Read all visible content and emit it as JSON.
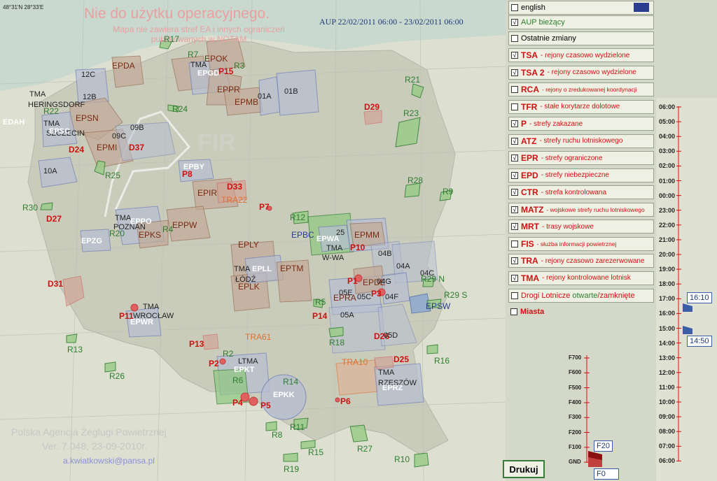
{
  "map": {
    "coords": "48°31'N  28°33'E",
    "warning": "Nie do użytku operacyjnego.",
    "warning_sub": "Mapa nie zawiera stref EA i innych ograniczeń publikowanych w NOTAM",
    "aup_range": "AUP 22/02/2011 06:00 - 23/02/2011 06:00",
    "org_line1": "Polska Agencja Żeglugi Powietrznej",
    "org_line2": "Ver.  7.048,    23-09-2010r.",
    "email": "a.kwiatkowski@pansa.pl",
    "fir": "FIR",
    "labels": [
      {
        "t": "R17",
        "c": "#2e7d2e"
      },
      {
        "t": "EPDA",
        "c": "#7a2a10"
      },
      {
        "t": "12C",
        "c": "#222"
      },
      {
        "t": "12B",
        "c": "#222"
      },
      {
        "t": "TMA",
        "c": "#222"
      },
      {
        "t": "HERINGSDORF",
        "c": "#222"
      },
      {
        "t": "R22",
        "c": "#2e7d2e"
      },
      {
        "t": "EDAH",
        "c": "#fff"
      },
      {
        "t": "EPSN",
        "c": "#7a2a10"
      },
      {
        "t": "TMA",
        "c": "#222"
      },
      {
        "t": "SZCZECIN",
        "c": "#222"
      },
      {
        "t": "EPSC",
        "c": "#fff"
      },
      {
        "t": "D24",
        "c": "#d01010"
      },
      {
        "t": "EPMI",
        "c": "#7a2a10"
      },
      {
        "t": "D37",
        "c": "#d01010"
      },
      {
        "t": "09C",
        "c": "#222"
      },
      {
        "t": "09B",
        "c": "#222"
      },
      {
        "t": "10A",
        "c": "#222"
      },
      {
        "t": "R25",
        "c": "#2e7d2e"
      },
      {
        "t": "R24",
        "c": "#2e7d2e"
      },
      {
        "t": "R7",
        "c": "#2e7d2e"
      },
      {
        "t": "EPOK",
        "c": "#7a2a10"
      },
      {
        "t": "R3",
        "c": "#2e7d2e"
      },
      {
        "t": "TMA",
        "c": "#222"
      },
      {
        "t": "EPGD",
        "c": "#fff"
      },
      {
        "t": "P15",
        "c": "#d01010"
      },
      {
        "t": "EPPR",
        "c": "#7a2a10"
      },
      {
        "t": "EPMB",
        "c": "#7a2a10"
      },
      {
        "t": "01A",
        "c": "#222"
      },
      {
        "t": "01B",
        "c": "#222"
      },
      {
        "t": "R21",
        "c": "#2e7d2e"
      },
      {
        "t": "D29",
        "c": "#d01010"
      },
      {
        "t": "R23",
        "c": "#2e7d2e"
      },
      {
        "t": "EPBY",
        "c": "#fff"
      },
      {
        "t": "P8",
        "c": "#d01010"
      },
      {
        "t": "D33",
        "c": "#d01010"
      },
      {
        "t": "EPIR",
        "c": "#7a2a10"
      },
      {
        "t": "TRA22",
        "c": "#e07030"
      },
      {
        "t": "P7",
        "c": "#d01010"
      },
      {
        "t": "R28",
        "c": "#2e7d2e"
      },
      {
        "t": "R9",
        "c": "#2e7d2e"
      },
      {
        "t": "R30",
        "c": "#2e7d2e"
      },
      {
        "t": "D27",
        "c": "#d01010"
      },
      {
        "t": "TMA",
        "c": "#222"
      },
      {
        "t": "POZNAN",
        "c": "#222"
      },
      {
        "t": "EPPO",
        "c": "#fff"
      },
      {
        "t": "EPKS",
        "c": "#7a2a10"
      },
      {
        "t": "EPPW",
        "c": "#7a2a10"
      },
      {
        "t": "R20",
        "c": "#2e7d2e"
      },
      {
        "t": "R4",
        "c": "#2e7d2e"
      },
      {
        "t": "EPZG",
        "c": "#fff"
      },
      {
        "t": "R12",
        "c": "#2e7d2e"
      },
      {
        "t": "EPBC",
        "c": "#2a3d8f"
      },
      {
        "t": "EPWA",
        "c": "#fff"
      },
      {
        "t": "25",
        "c": "#222"
      },
      {
        "t": "EPMM",
        "c": "#7a2a10"
      },
      {
        "t": "TMA",
        "c": "#222"
      },
      {
        "t": "W-WA",
        "c": "#222"
      },
      {
        "t": "P10",
        "c": "#d01010"
      },
      {
        "t": "EPLY",
        "c": "#7a2a10"
      },
      {
        "t": "TMA",
        "c": "#222"
      },
      {
        "t": "ŁÓDŹ",
        "c": "#222"
      },
      {
        "t": "EPLL",
        "c": "#fff"
      },
      {
        "t": "EPLK",
        "c": "#7a2a10"
      },
      {
        "t": "EPTM",
        "c": "#7a2a10"
      },
      {
        "t": "04B",
        "c": "#222"
      },
      {
        "t": "04A",
        "c": "#222"
      },
      {
        "t": "04C",
        "c": "#222"
      },
      {
        "t": "R29 N",
        "c": "#2e7d2e"
      },
      {
        "t": "R29 S",
        "c": "#2e7d2e"
      },
      {
        "t": "EPSW",
        "c": "#2a3d8f"
      },
      {
        "t": "D31",
        "c": "#d01010"
      },
      {
        "t": "P1",
        "c": "#d01010"
      },
      {
        "t": "EPDE",
        "c": "#7a2a10"
      },
      {
        "t": "05E",
        "c": "#222"
      },
      {
        "t": "EPRA",
        "c": "#7a2a10"
      },
      {
        "t": "05C",
        "c": "#222"
      },
      {
        "t": "P3",
        "c": "#d01010"
      },
      {
        "t": "04G",
        "c": "#222"
      },
      {
        "t": "04F",
        "c": "#222"
      },
      {
        "t": "R5",
        "c": "#2e7d2e"
      },
      {
        "t": "P14",
        "c": "#d01010"
      },
      {
        "t": "05A",
        "c": "#222"
      },
      {
        "t": "TMA",
        "c": "#222"
      },
      {
        "t": "WROCŁAW",
        "c": "#222"
      },
      {
        "t": "EPWR",
        "c": "#fff"
      },
      {
        "t": "P11",
        "c": "#d01010"
      },
      {
        "t": "TRA61",
        "c": "#e07030"
      },
      {
        "t": "R18",
        "c": "#2e7d2e"
      },
      {
        "t": "D26",
        "c": "#d01010"
      },
      {
        "t": "05D",
        "c": "#222"
      },
      {
        "t": "P13",
        "c": "#d01010"
      },
      {
        "t": "R13",
        "c": "#2e7d2e"
      },
      {
        "t": "R2",
        "c": "#2e7d2e"
      },
      {
        "t": "P2",
        "c": "#d01010"
      },
      {
        "t": "LTMA",
        "c": "#222"
      },
      {
        "t": "EPKT",
        "c": "#fff"
      },
      {
        "t": "R6",
        "c": "#2e7d2e"
      },
      {
        "t": "TRA10",
        "c": "#e07030"
      },
      {
        "t": "D25",
        "c": "#d01010"
      },
      {
        "t": "R16",
        "c": "#2e7d2e"
      },
      {
        "t": "R26",
        "c": "#2e7d2e"
      },
      {
        "t": "TMA",
        "c": "#222"
      },
      {
        "t": "RZESZÓW",
        "c": "#222"
      },
      {
        "t": "EPRZ",
        "c": "#fff"
      },
      {
        "t": "R14",
        "c": "#2e7d2e"
      },
      {
        "t": "EPKK",
        "c": "#fff"
      },
      {
        "t": "P4",
        "c": "#d01010"
      },
      {
        "t": "P5",
        "c": "#d01010"
      },
      {
        "t": "P6",
        "c": "#d01010"
      },
      {
        "t": "R11",
        "c": "#2e7d2e"
      },
      {
        "t": "R8",
        "c": "#2e7d2e"
      },
      {
        "t": "R15",
        "c": "#2e7d2e"
      },
      {
        "t": "R27",
        "c": "#2e7d2e"
      },
      {
        "t": "R10",
        "c": "#2e7d2e"
      },
      {
        "t": "R19",
        "c": "#2e7d2e"
      }
    ]
  },
  "panel": {
    "english": "english",
    "aup_current": "AUP bieżący",
    "recent_changes": "Ostatnie zmiany",
    "layers": [
      {
        "code": "TSA",
        "desc": "- rejony czasowo wydzielone",
        "checked": true
      },
      {
        "code": "TSA 2",
        "desc": "- rejony czasowo wydzielone",
        "checked": true
      },
      {
        "code": "RCA",
        "desc": "- rejony o zredukowanej koordynacji",
        "checked": false
      },
      {
        "code": "TFR",
        "desc": "- stałe korytarze dolotowe",
        "checked": false
      },
      {
        "code": "P",
        "desc": "- strefy zakazane",
        "checked": true
      },
      {
        "code": "ATZ",
        "desc": "- strefy ruchu lotniskowego",
        "checked": true
      },
      {
        "code": "EPR",
        "desc": "- strefy ograniczone",
        "checked": true
      },
      {
        "code": "EPD",
        "desc": "- strefy niebezpieczne",
        "checked": true
      },
      {
        "code": "CTR",
        "desc": "- strefa kontrolowana",
        "checked": true
      },
      {
        "code": "MATZ",
        "desc": "- wojskowe strefy ruchu lotniskowego",
        "checked": true
      },
      {
        "code": "MRT",
        "desc": "- trasy wojskowe",
        "checked": true
      },
      {
        "code": "FIS",
        "desc": "- służba informacji  powietrznej",
        "checked": false
      },
      {
        "code": "TRA",
        "desc": "- rejony czasowo zarezerwowane",
        "checked": true
      },
      {
        "code": "TMA",
        "desc": "- rejony kontrolowane lotnisk",
        "checked": true
      }
    ],
    "routes_part1": "Drogi Lotnicze ",
    "routes_open": "otwarte",
    "routes_sep": "/",
    "routes_closed": "zamknięte",
    "cities": "Miasta",
    "print": "Drukuj"
  },
  "altitude": {
    "levels": [
      "F700",
      "F600",
      "F500",
      "F400",
      "F300",
      "F200",
      "F100",
      "GND"
    ],
    "upper_value": "F20",
    "lower_value": "F0"
  },
  "time": {
    "ticks": [
      "06:00",
      "05:00",
      "04:00",
      "03:00",
      "02:00",
      "01:00",
      "00:00",
      "23:00",
      "22:00",
      "21:00",
      "20:00",
      "19:00",
      "18:00",
      "17:00",
      "16:00",
      "15:00",
      "14:00",
      "13:00",
      "12:00",
      "11:00",
      "10:00",
      "09:00",
      "08:00",
      "07:00",
      "06:00"
    ],
    "upper_value": "16:10",
    "lower_value": "14:50"
  },
  "colors": {
    "red": "#d01010",
    "green": "#2e7d2e",
    "blue": "#2a3d8f",
    "brown": "#7a2a10"
  }
}
